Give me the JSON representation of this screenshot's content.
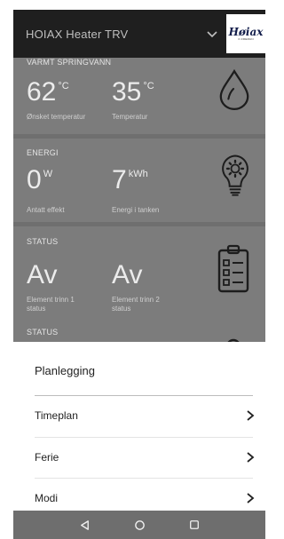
{
  "header": {
    "title": "HOIAX Heater TRV",
    "logo_text": "Høiax",
    "logo_sub": "O.FREMAN"
  },
  "cards": {
    "water": {
      "caption": "VARMT SPRINGVANN",
      "left_value": "62",
      "left_unit": "°C",
      "left_label": "Ønsket temperatur",
      "right_value": "35",
      "right_unit": "°C",
      "right_label": "Temperatur",
      "icon": "water-drop-icon"
    },
    "energy": {
      "caption": "ENERGI",
      "left_value": "0",
      "left_unit": "W",
      "left_label": "Antatt effekt",
      "right_value": "7",
      "right_unit": "kWh",
      "right_label": "Energi i tanken",
      "icon": "lightbulb-gear-icon"
    },
    "status": {
      "caption": "STATUS",
      "left_value": "Av",
      "left_label_1": "Element trinn 1",
      "left_label_2": "status",
      "right_value": "Av",
      "right_label_1": "Element trinn 2",
      "right_label_2": "status",
      "icon": "clipboard-checklist-icon"
    },
    "status2": {
      "caption": "STATUS"
    }
  },
  "sheet": {
    "title": "Planlegging",
    "items": [
      {
        "label": "Timeplan"
      },
      {
        "label": "Ferie"
      },
      {
        "label": "Modi"
      }
    ]
  },
  "navbar": {
    "buttons": [
      "back-icon",
      "home-icon",
      "recents-icon"
    ]
  },
  "colors": {
    "header_bg": "#1f1f1f",
    "overlay": "#7c7c7c",
    "sheet_bg": "#ffffff",
    "navbar_bg": "#6e6e6e"
  }
}
